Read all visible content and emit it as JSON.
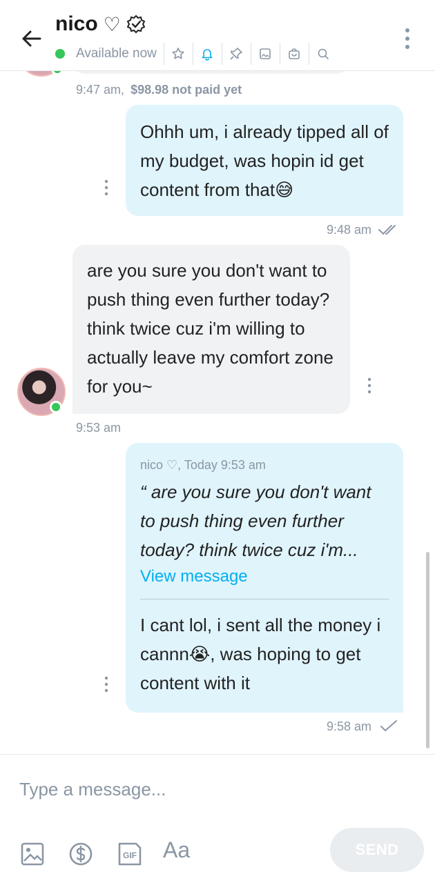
{
  "header": {
    "name": "nico",
    "heart": "♡",
    "status": "Available now",
    "icons": [
      "star-icon",
      "bell-icon",
      "pin-icon",
      "image-icon",
      "shop-icon",
      "search-icon"
    ],
    "accent": "#00aff0",
    "online_color": "#35c759"
  },
  "messages": {
    "m0_time": "9:47 am,",
    "m0_price": "$98.98 not paid yet",
    "m1_text": "Ohhh um, i already tipped all of my budget, was hopin id get content from that😅",
    "m1_time": "9:48 am",
    "m2_text": "are you sure you don't want to push thing even further today? think twice cuz i'm willing to actually leave my comfort zone for you~",
    "m2_time": "9:53 am",
    "m3_quote_meta": "nico ♡, Today 9:53 am",
    "m3_quote_text": "“ are you sure you don't want to push thing even further today? think twice cuz i'm...",
    "m3_view": "View message",
    "m3_text": "I cant lol, i sent all the money i cannn😭, was hoping to get content with it",
    "m3_time": "9:58 am"
  },
  "composer": {
    "placeholder": "Type a message...",
    "aa": "Aa",
    "send": "SEND"
  }
}
